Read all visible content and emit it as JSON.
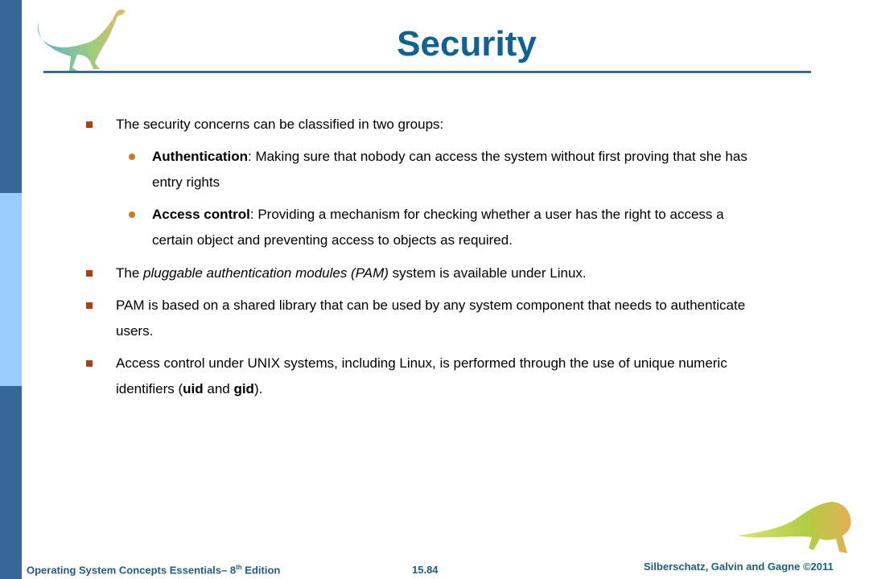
{
  "slide": {
    "title": "Security",
    "colors": {
      "title": "#0f6394",
      "sidebar_dark": "#35679a",
      "sidebar_light": "#99ccff",
      "bullet_square": "#b23c0c",
      "bullet_dot": "#cc7a22",
      "footer_text": "#1f5c80"
    },
    "bullets": [
      {
        "text": "The security concerns can be classified in two groups:"
      },
      {
        "sub": [
          {
            "bold": "Authentication",
            "rest_line1": ": Making sure that nobody can access the system without first proving that she has",
            "rest_line2": "entry rights"
          },
          {
            "bold": "Access control",
            "rest_line1": ": Providing a mechanism for checking whether a user has the right to access a",
            "rest_line2": "certain object and preventing access to objects as required."
          }
        ]
      },
      {
        "pre": "The ",
        "italic": "pluggable authentication modules (PAM)",
        "post": " system is available under Linux."
      },
      {
        "line1": "PAM is based on a shared library that can be used by any system component that needs to authenticate",
        "line2": "users."
      },
      {
        "line1": "Access control under UNIX systems, including Linux, is performed through the use of unique numeric",
        "line2_pre": "identifiers (",
        "line2_b1": "uid",
        "line2_mid": " and ",
        "line2_b2": "gid",
        "line2_post": ")."
      }
    ]
  },
  "footer": {
    "book_title_pre": "Operating System Concepts Essentials– 8",
    "book_title_sup": "th",
    "book_title_post": " Edition",
    "page_number": "15.84",
    "copyright": "Silberschatz, Galvin and Gagne ©2011"
  }
}
